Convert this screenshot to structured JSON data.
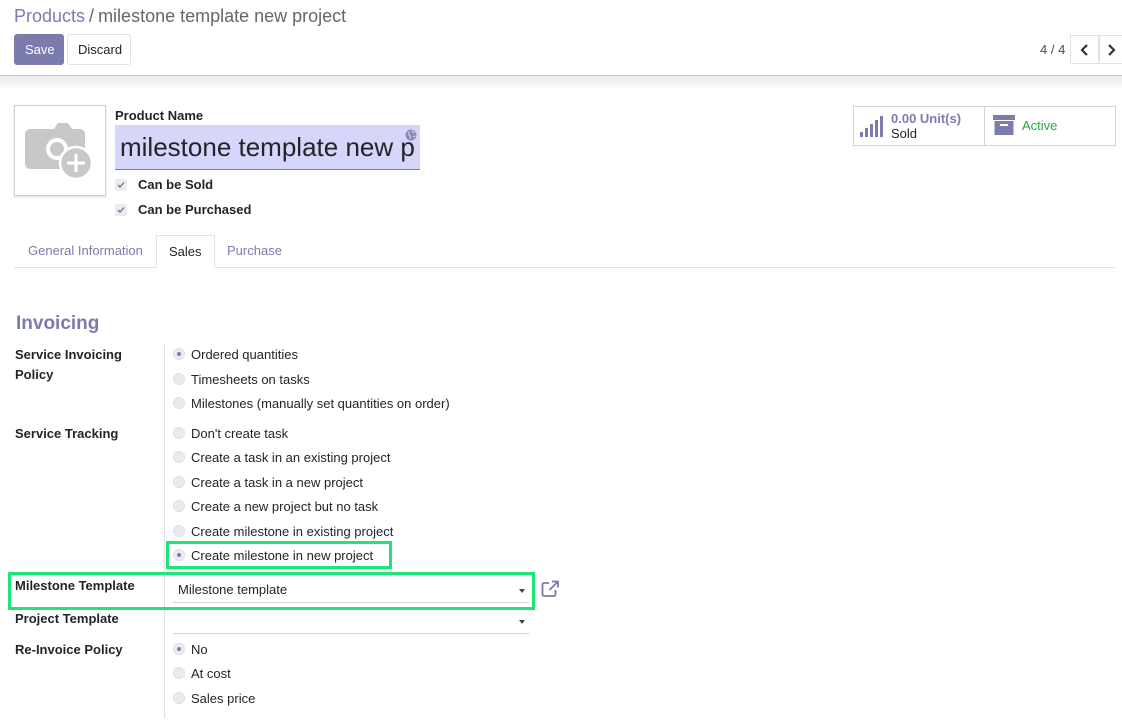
{
  "breadcrumb": {
    "parent": "Products",
    "separator": "/",
    "current": "milestone template new project"
  },
  "buttons": {
    "save": "Save",
    "discard": "Discard"
  },
  "pager": {
    "value": "4 / 4"
  },
  "product": {
    "name_label": "Product Name",
    "name_value": "milestone template new p",
    "can_be_sold": "Can be Sold",
    "can_be_purchased": "Can be Purchased"
  },
  "stats": {
    "sold_value": "0.00 Unit(s)",
    "sold_label": "Sold",
    "active_label": "Active"
  },
  "tabs": [
    "General Information",
    "Sales",
    "Purchase"
  ],
  "invoicing": {
    "title": "Invoicing",
    "policy_label": "Service Invoicing Policy",
    "policy_options": [
      "Ordered quantities",
      "Timesheets on tasks",
      "Milestones (manually set quantities on order)"
    ],
    "tracking_label": "Service Tracking",
    "tracking_options": [
      "Don't create task",
      "Create a task in an existing project",
      "Create a task in a new project",
      "Create a new project but no task",
      "Create milestone in existing project",
      "Create milestone in new project"
    ],
    "milestone_template_label": "Milestone Template",
    "milestone_template_value": "Milestone template",
    "project_template_label": "Project Template",
    "project_template_value": "",
    "reinvoice_label": "Re-Invoice Policy",
    "reinvoice_options": [
      "No",
      "At cost",
      "Sales price"
    ]
  },
  "colors": {
    "accent": "#7c7bad",
    "highlight": "#1ee578",
    "active": "#28a745"
  }
}
